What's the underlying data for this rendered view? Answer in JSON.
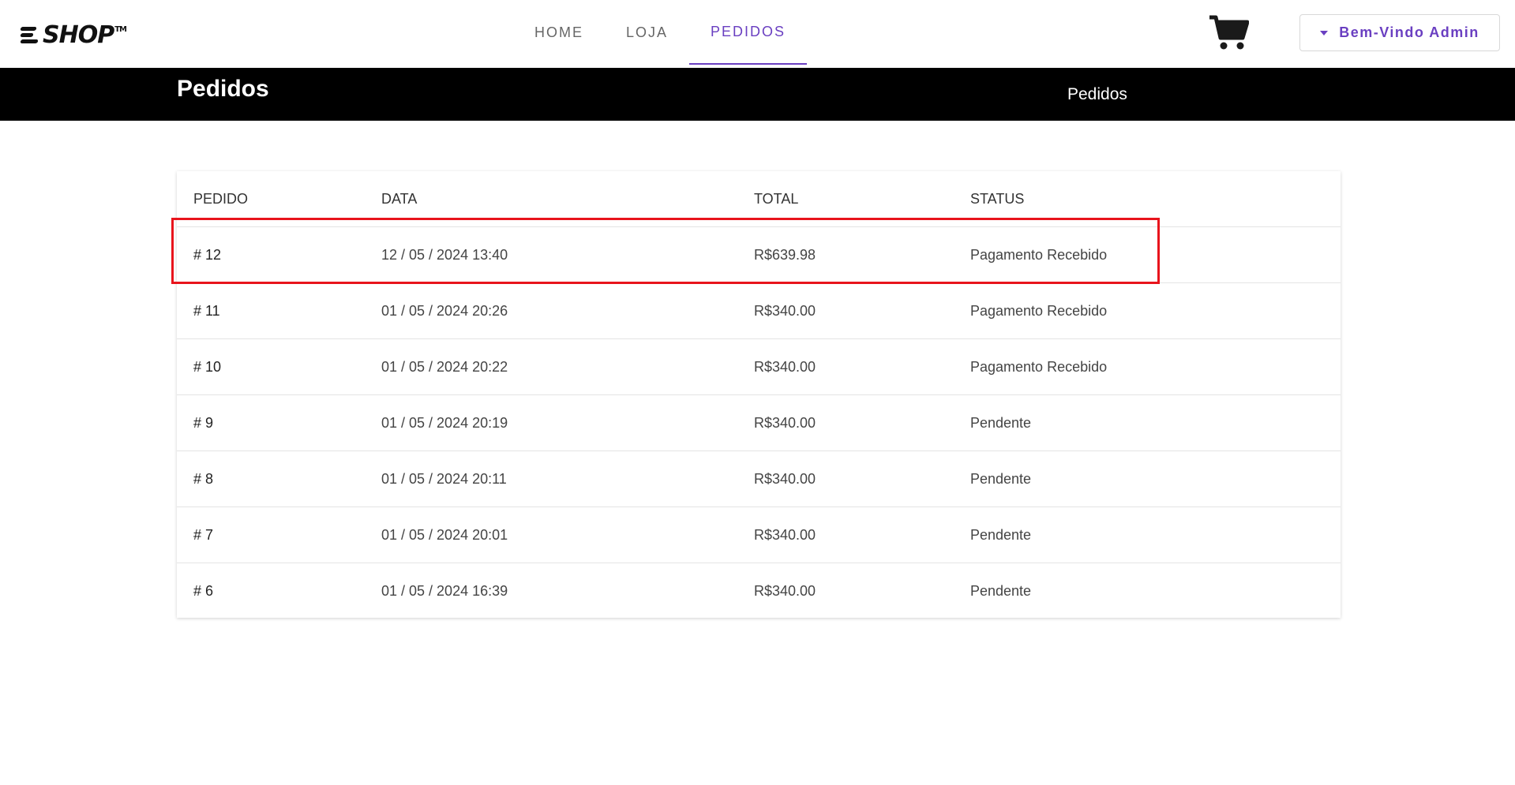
{
  "brand": {
    "logo_text": "SHOP",
    "logo_tm": "TM"
  },
  "nav": {
    "links": [
      {
        "label": "HOME",
        "active": false
      },
      {
        "label": "LOJA",
        "active": false
      },
      {
        "label": "PEDIDOS",
        "active": true
      }
    ]
  },
  "header": {
    "cart_icon": "shopping-cart-icon",
    "user_button_label": "Bem-Vindo Admin",
    "user_button_icon": "caret-down-icon"
  },
  "banner": {
    "title": "Pedidos",
    "breadcrumb": "Pedidos"
  },
  "orders_table": {
    "columns": [
      "PEDIDO",
      "DATA",
      "TOTAL",
      "STATUS"
    ],
    "rows": [
      {
        "id": "# 12",
        "date": "12 / 05 / 2024 13:40",
        "total": "R$639.98",
        "status": "Pagamento Recebido"
      },
      {
        "id": "# 11",
        "date": "01 / 05 / 2024 20:26",
        "total": "R$340.00",
        "status": "Pagamento Recebido"
      },
      {
        "id": "# 10",
        "date": "01 / 05 / 2024 20:22",
        "total": "R$340.00",
        "status": "Pagamento Recebido"
      },
      {
        "id": "# 9",
        "date": "01 / 05 / 2024 20:19",
        "total": "R$340.00",
        "status": "Pendente"
      },
      {
        "id": "# 8",
        "date": "01 / 05 / 2024 20:11",
        "total": "R$340.00",
        "status": "Pendente"
      },
      {
        "id": "# 7",
        "date": "01 / 05 / 2024 20:01",
        "total": "R$340.00",
        "status": "Pendente"
      },
      {
        "id": "# 6",
        "date": "01 / 05 / 2024 16:39",
        "total": "R$340.00",
        "status": "Pendente"
      }
    ]
  },
  "colors": {
    "accent": "#6a3fc1",
    "highlight": "#e8141c",
    "banner_bg": "#000000"
  }
}
